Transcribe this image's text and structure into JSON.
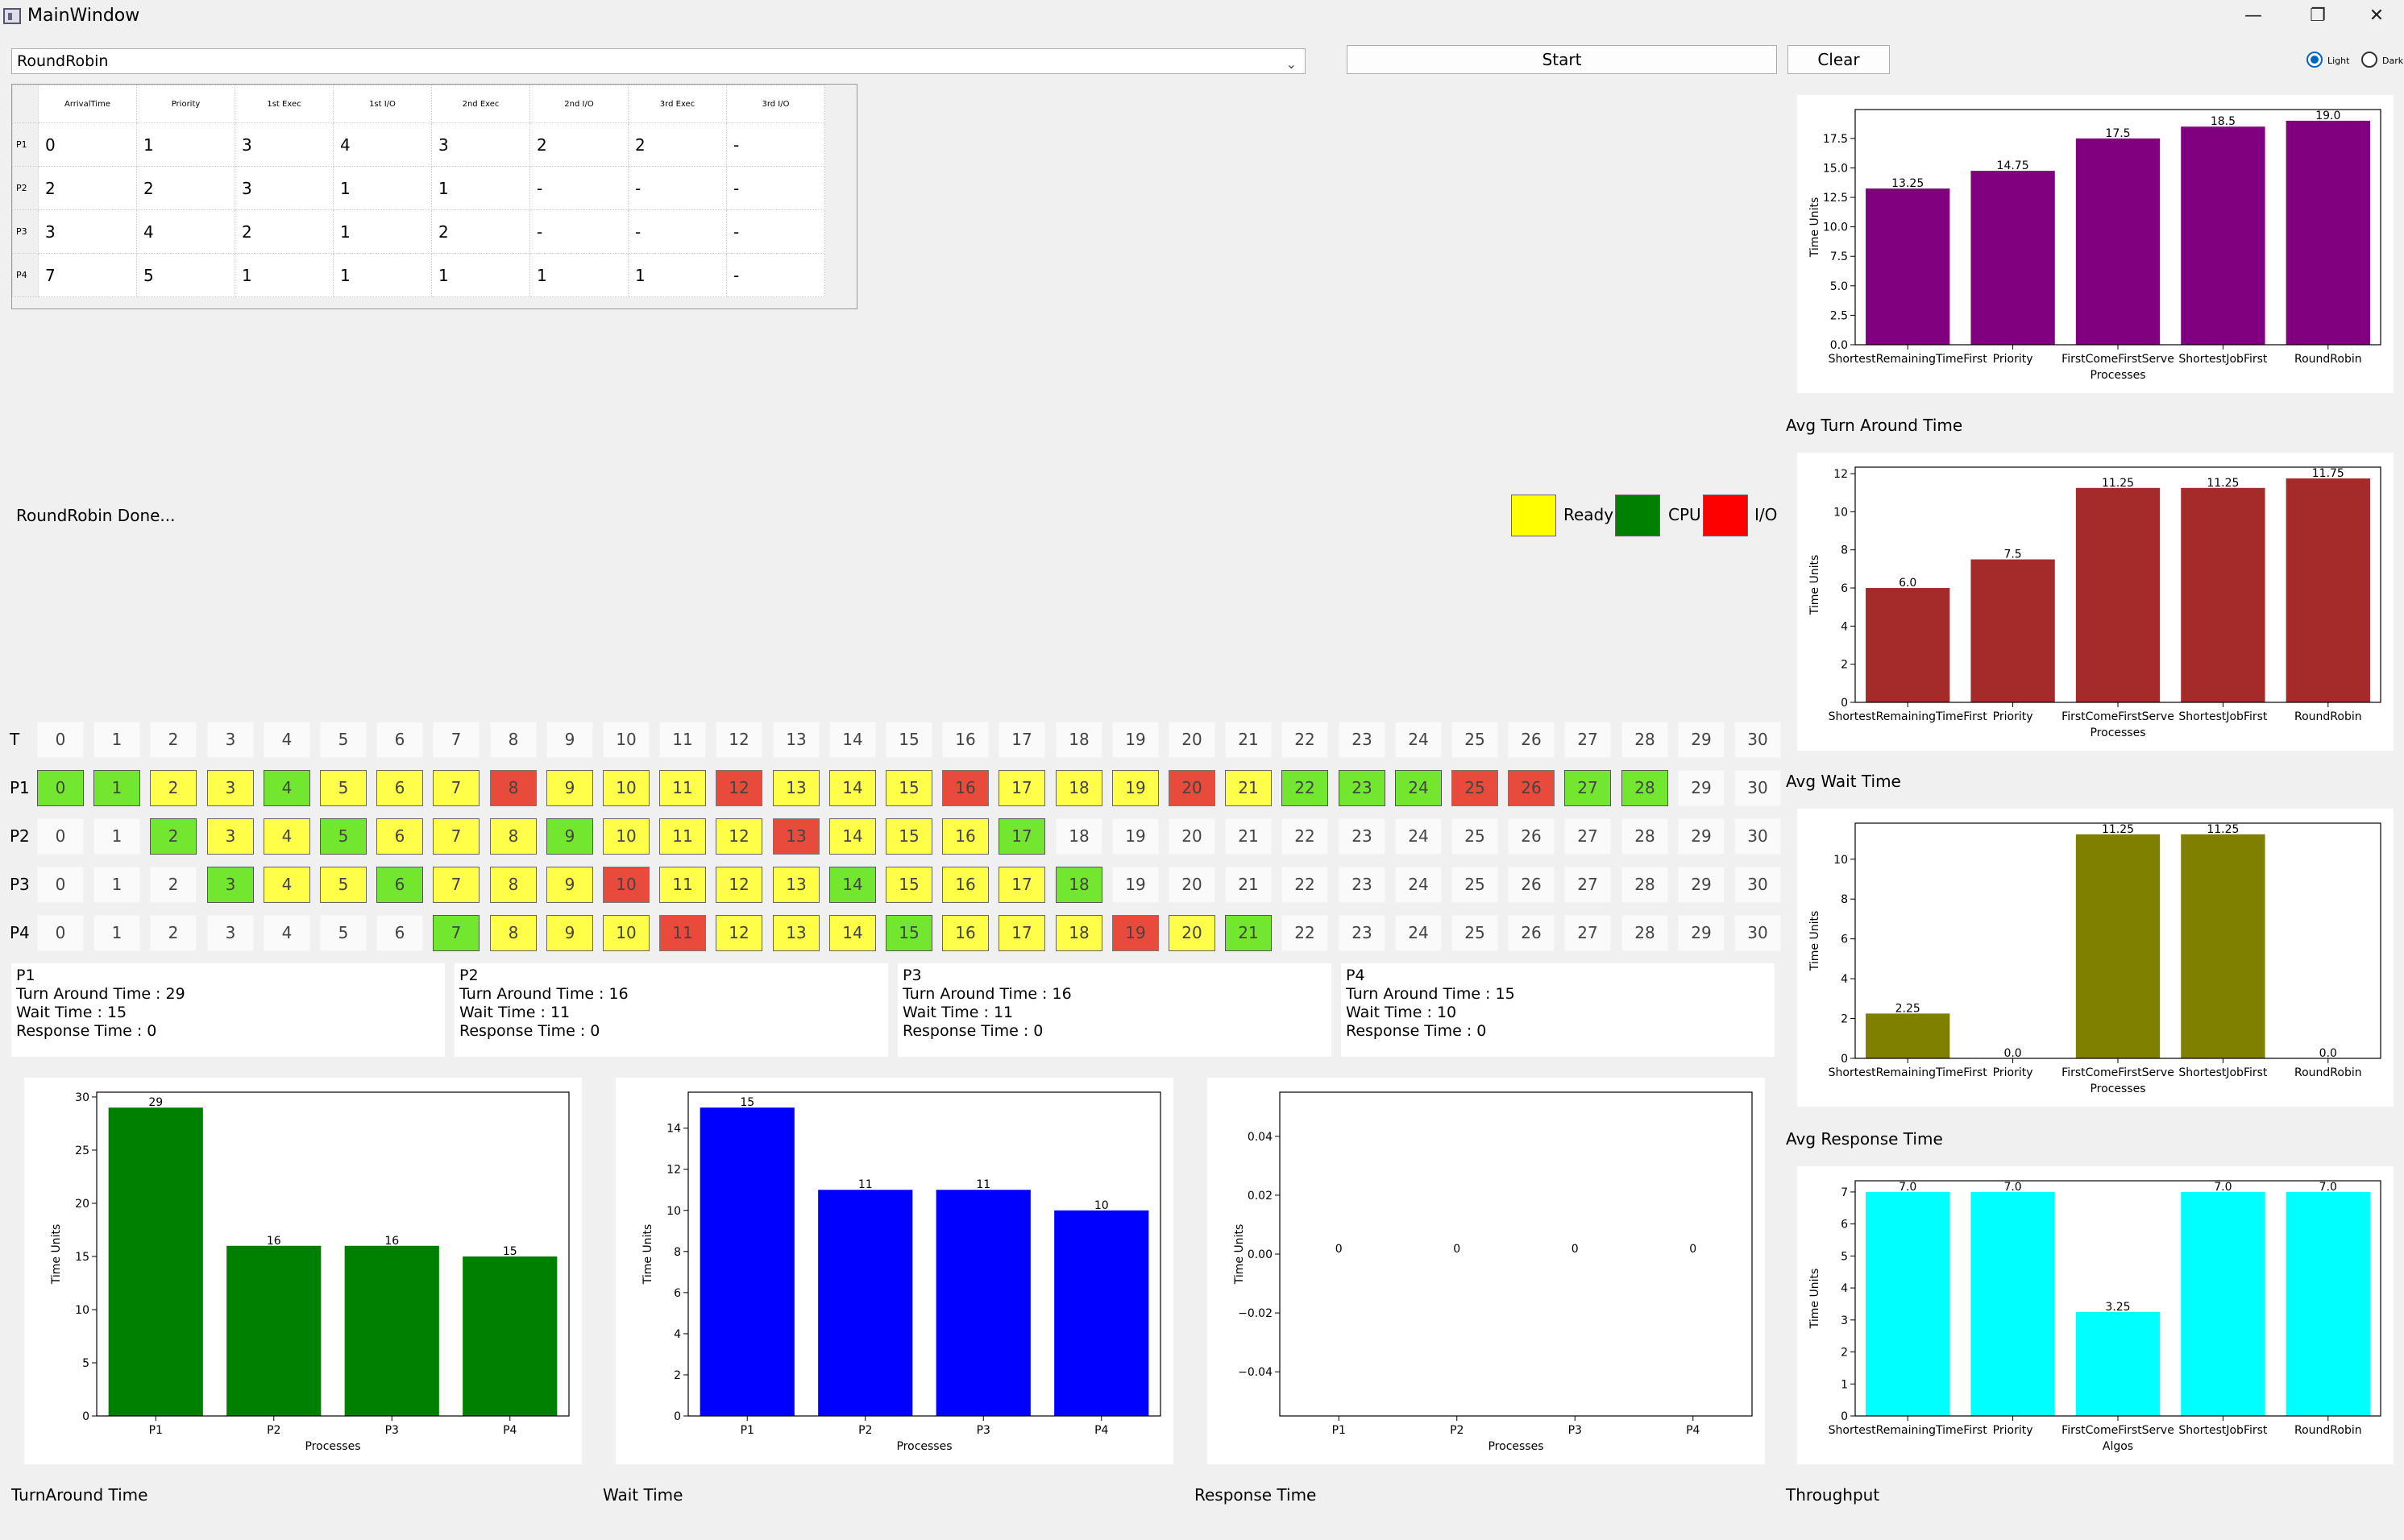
{
  "window": {
    "title": "MainWindow",
    "minimize": "—",
    "restore": "❐",
    "close": "✕"
  },
  "toolbar": {
    "algorithm": "RoundRobin",
    "start_label": "Start",
    "clear_label": "Clear",
    "theme_light": "Light",
    "theme_dark": "Dark"
  },
  "process_table": {
    "columns": [
      "ArrivalTime",
      "Priority",
      "1st Exec",
      "1st I/O",
      "2nd Exec",
      "2nd I/O",
      "3rd Exec",
      "3rd I/O"
    ],
    "rows": [
      {
        "label": "P1",
        "cells": [
          "0",
          "1",
          "3",
          "4",
          "3",
          "2",
          "2",
          "-"
        ]
      },
      {
        "label": "P2",
        "cells": [
          "2",
          "2",
          "3",
          "1",
          "1",
          "-",
          "-",
          "-"
        ]
      },
      {
        "label": "P3",
        "cells": [
          "3",
          "4",
          "2",
          "1",
          "2",
          "-",
          "-",
          "-"
        ]
      },
      {
        "label": "P4",
        "cells": [
          "7",
          "5",
          "1",
          "1",
          "1",
          "1",
          "1",
          "-"
        ]
      }
    ]
  },
  "status": "RoundRobin Done...",
  "legend": {
    "ready": "Ready",
    "cpu": "CPU",
    "io": "I/O",
    "ready_color": "#ffff00",
    "cpu_color": "#008000",
    "io_color": "#ff0000"
  },
  "timeline": {
    "header_label": "T",
    "ticks": [
      "0",
      "1",
      "2",
      "3",
      "4",
      "5",
      "6",
      "7",
      "8",
      "9",
      "10",
      "11",
      "12",
      "13",
      "14",
      "15",
      "16",
      "17",
      "18",
      "19",
      "20",
      "21",
      "22",
      "23",
      "24",
      "25",
      "26",
      "27",
      "28",
      "29",
      "30"
    ],
    "rows": [
      {
        "label": "P1",
        "states": "GGYYGYYYRYYYRYYYRYYYRYGGGRRGGNN"
      },
      {
        "label": "P2",
        "states": "NNGYYGYYYGYYYRYYYGNNNNNNNNNNNNN"
      },
      {
        "label": "P3",
        "states": "NNNGYYGYYYRYYYGYYYGNNNNNNNNNNNN"
      },
      {
        "label": "P4",
        "states": "NNNNNNNGYYYRYYYGYYYRYGNNNNNNNNN"
      }
    ]
  },
  "process_stats": [
    {
      "name": "P1",
      "turnaround": "Turn Around Time : 29",
      "wait": "Wait Time : 15",
      "response": "Response Time : 0"
    },
    {
      "name": "P2",
      "turnaround": "Turn Around Time : 16",
      "wait": "Wait Time : 11",
      "response": "Response Time : 0"
    },
    {
      "name": "P3",
      "turnaround": "Turn Around Time : 16",
      "wait": "Wait Time : 11",
      "response": "Response Time : 0"
    },
    {
      "name": "P4",
      "turnaround": "Turn Around Time : 15",
      "wait": "Wait Time : 10",
      "response": "Response Time : 0"
    }
  ],
  "captions": {
    "turnaround": "TurnAround Time",
    "wait": "Wait Time",
    "response": "Response Time",
    "throughput": "Throughput",
    "avg_turnaround": "Avg Turn Around Time",
    "avg_wait": "Avg Wait Time",
    "avg_response": "Avg Response Time"
  },
  "chart_data": [
    {
      "id": "avg-turnaround",
      "type": "bar",
      "color": "#800080",
      "categories": [
        "ShortestRemainingTimeFirst",
        "Priority",
        "FirstComeFirstServe",
        "ShortestJobFirst",
        "RoundRobin"
      ],
      "values": [
        13.25,
        14.75,
        17.5,
        18.5,
        19.0
      ],
      "labels": [
        "13.25",
        "14.75",
        "17.5",
        "18.5",
        "19.0"
      ],
      "xlabel": "Processes",
      "ylabel": "Time Units",
      "ylim": [
        0,
        19.95
      ],
      "ticks": [
        0,
        2.5,
        5,
        7.5,
        10,
        12.5,
        15,
        17.5
      ],
      "tick_labels": [
        "0.0",
        "2.5",
        "5.0",
        "7.5",
        "10.0",
        "12.5",
        "15.0",
        "17.5"
      ]
    },
    {
      "id": "avg-wait",
      "type": "bar",
      "color": "#a52a2a",
      "categories": [
        "ShortestRemainingTimeFirst",
        "Priority",
        "FirstComeFirstServe",
        "ShortestJobFirst",
        "RoundRobin"
      ],
      "values": [
        6.0,
        7.5,
        11.25,
        11.25,
        11.75
      ],
      "labels": [
        "6.0",
        "7.5",
        "11.25",
        "11.25",
        "11.75"
      ],
      "xlabel": "Processes",
      "ylabel": "Time Units",
      "ylim": [
        0,
        12.34
      ],
      "ticks": [
        0,
        2,
        4,
        6,
        8,
        10,
        12
      ],
      "tick_labels": [
        "0",
        "2",
        "4",
        "6",
        "8",
        "10",
        "12"
      ]
    },
    {
      "id": "avg-response",
      "type": "bar",
      "color": "#808000",
      "categories": [
        "ShortestRemainingTimeFirst",
        "Priority",
        "FirstComeFirstServe",
        "ShortestJobFirst",
        "RoundRobin"
      ],
      "values": [
        2.25,
        0.0,
        11.25,
        11.25,
        0.0
      ],
      "labels": [
        "2.25",
        "0.0",
        "11.25",
        "11.25",
        "0.0"
      ],
      "xlabel": "Processes",
      "ylabel": "Time Units",
      "ylim": [
        0,
        11.81
      ],
      "ticks": [
        0,
        2,
        4,
        6,
        8,
        10
      ],
      "tick_labels": [
        "0",
        "2",
        "4",
        "6",
        "8",
        "10"
      ]
    },
    {
      "id": "throughput",
      "type": "bar",
      "color": "#00ffff",
      "categories": [
        "ShortestRemainingTimeFirst",
        "Priority",
        "FirstComeFirstServe",
        "ShortestJobFirst",
        "RoundRobin"
      ],
      "values": [
        7.0,
        7.0,
        3.25,
        7.0,
        7.0
      ],
      "labels": [
        "7.0",
        "7.0",
        "3.25",
        "7.0",
        "7.0"
      ],
      "xlabel": "Algos",
      "ylabel": "Time Units",
      "ylim": [
        0,
        7.35
      ],
      "ticks": [
        0,
        1,
        2,
        3,
        4,
        5,
        6,
        7
      ],
      "tick_labels": [
        "0",
        "1",
        "2",
        "3",
        "4",
        "5",
        "6",
        "7"
      ]
    },
    {
      "id": "turnaround",
      "type": "bar",
      "color": "#008000",
      "categories": [
        "P1",
        "P2",
        "P3",
        "P4"
      ],
      "values": [
        29,
        16,
        16,
        15
      ],
      "labels": [
        "29",
        "16",
        "16",
        "15"
      ],
      "xlabel": "Processes",
      "ylabel": "Time Units",
      "ylim": [
        0,
        30.45
      ],
      "ticks": [
        0,
        5,
        10,
        15,
        20,
        25,
        30
      ],
      "tick_labels": [
        "0",
        "5",
        "10",
        "15",
        "20",
        "25",
        "30"
      ]
    },
    {
      "id": "wait",
      "type": "bar",
      "color": "#0000ff",
      "categories": [
        "P1",
        "P2",
        "P3",
        "P4"
      ],
      "values": [
        15,
        11,
        11,
        10
      ],
      "labels": [
        "15",
        "11",
        "11",
        "10"
      ],
      "xlabel": "Processes",
      "ylabel": "Time Units",
      "ylim": [
        0,
        15.75
      ],
      "ticks": [
        0,
        2,
        4,
        6,
        8,
        10,
        12,
        14
      ],
      "tick_labels": [
        "0",
        "2",
        "4",
        "6",
        "8",
        "10",
        "12",
        "14"
      ]
    },
    {
      "id": "response",
      "type": "bar",
      "color": "#0000ff",
      "categories": [
        "P1",
        "P2",
        "P3",
        "P4"
      ],
      "values": [
        0,
        0,
        0,
        0
      ],
      "labels": [
        "0",
        "0",
        "0",
        "0"
      ],
      "xlabel": "Processes",
      "ylabel": "Time Units",
      "ylim": [
        -0.055,
        0.055
      ],
      "ticks": [
        -0.04,
        -0.02,
        0,
        0.02,
        0.04
      ],
      "tick_labels": [
        "−0.04",
        "−0.02",
        "0.00",
        "0.02",
        "0.04"
      ]
    }
  ]
}
